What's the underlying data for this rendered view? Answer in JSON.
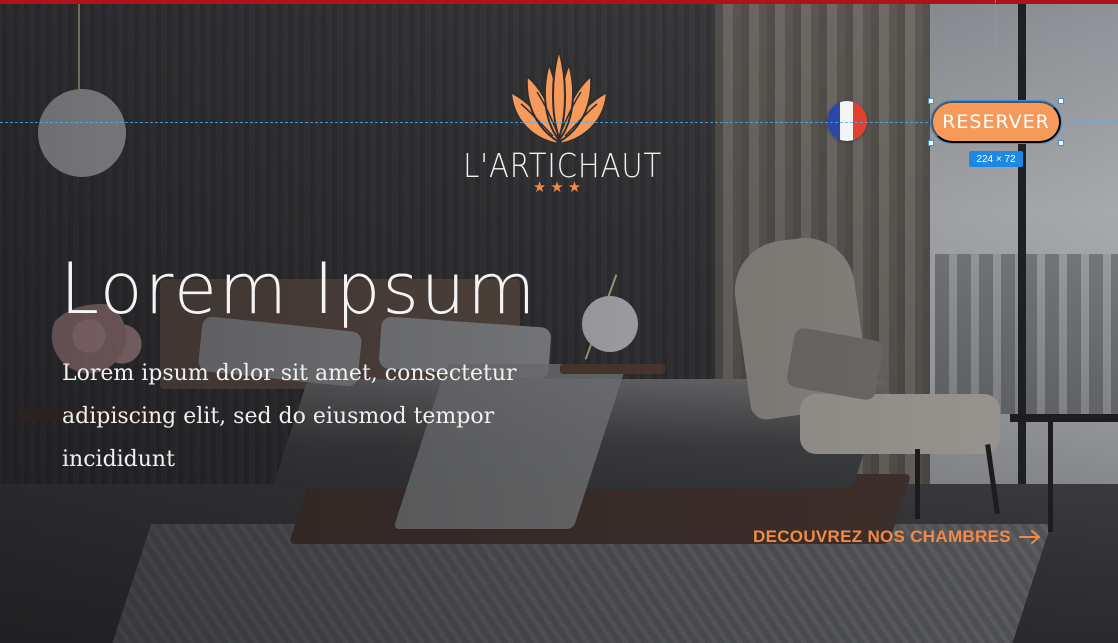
{
  "brand": {
    "name": "L'ARTICHAUT",
    "stars": "★★★",
    "accent_color": "#f28a45"
  },
  "header": {
    "language_flag": "flag-france-icon",
    "reserve_label": "RESERVER",
    "selection_size_label": "224 × 72"
  },
  "hero": {
    "title": "Lorem Ipsum",
    "text": "Lorem ipsum dolor sit amet, consectetur adipiscing elit, sed do eiusmod tempor incididunt",
    "cta_label": "DECOUVREZ NOS CHAMBRES",
    "cta_icon": "arrow-right-icon"
  }
}
